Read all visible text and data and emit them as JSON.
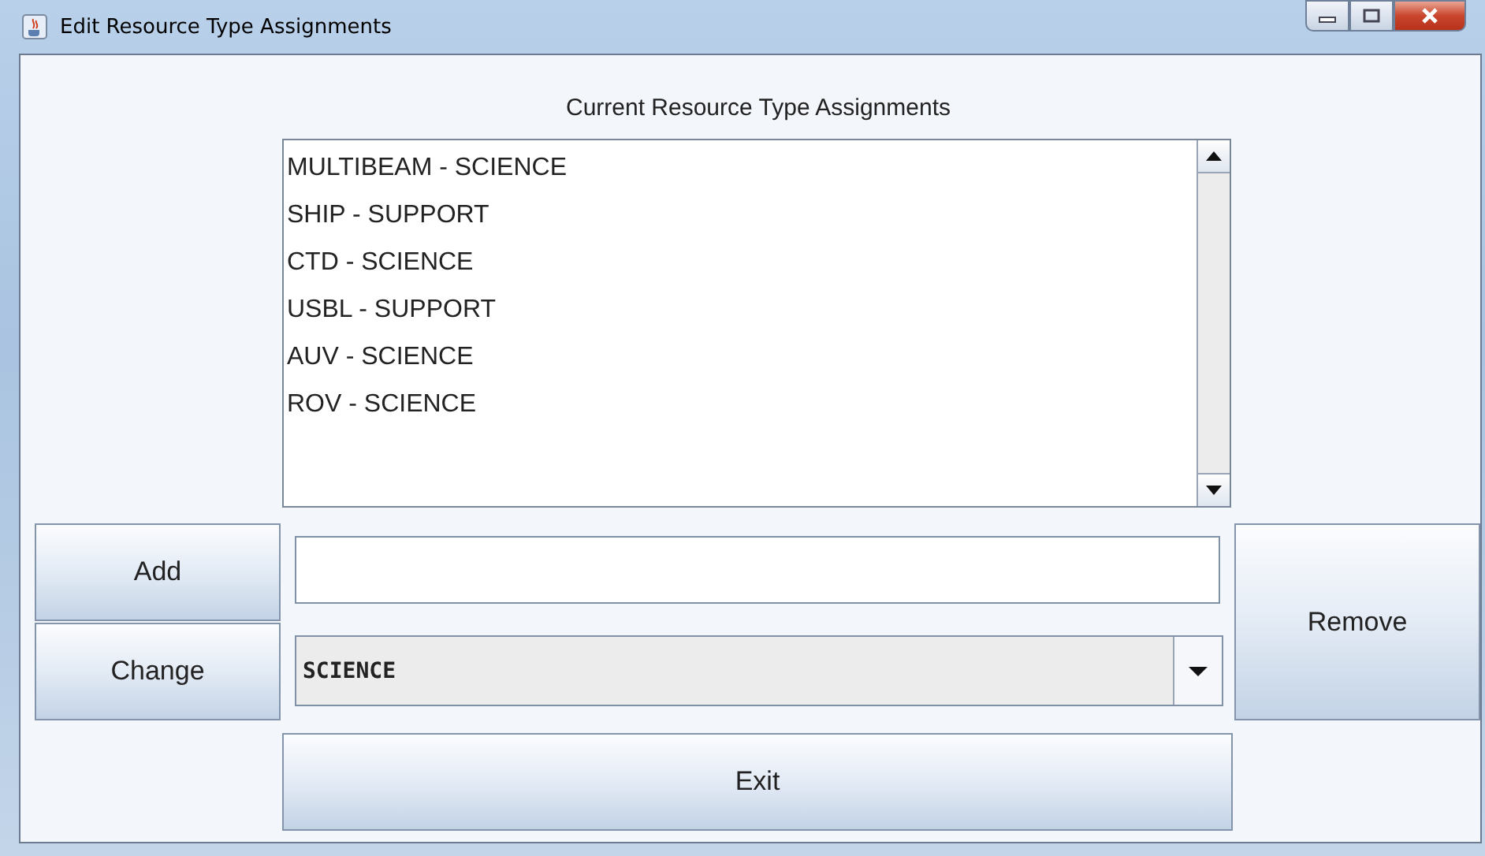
{
  "window": {
    "title": "Edit Resource Type Assignments"
  },
  "heading": "Current Resource Type Assignments",
  "assignments": [
    {
      "label": "MULTIBEAM - SCIENCE",
      "selected": false
    },
    {
      "label": "SHIP - SUPPORT",
      "selected": false
    },
    {
      "label": "CTD - SCIENCE",
      "selected": false
    },
    {
      "label": "USBL - SUPPORT",
      "selected": false
    },
    {
      "label": "AUV - SCIENCE",
      "selected": false
    },
    {
      "label": "ROV - SCIENCE",
      "selected": false
    }
  ],
  "buttons": {
    "add": "Add",
    "change": "Change",
    "remove": "Remove",
    "exit": "Exit"
  },
  "type_dropdown": {
    "value": "SCIENCE"
  }
}
